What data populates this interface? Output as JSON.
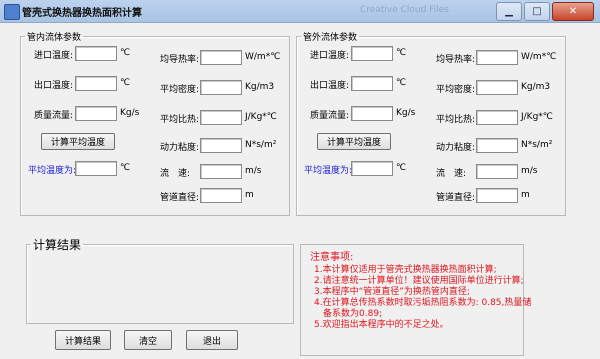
{
  "window": {
    "title": "管壳式换热器换热面积计算",
    "overlay_text": "Creative Cloud Files"
  },
  "inner_panel": {
    "legend": "管内流体参数",
    "inlet_temp_label": "进口温度:",
    "outlet_temp_label": "出口温度:",
    "mass_flow_label": "质量流量:",
    "avg_temp_button": "计算平均温度",
    "avg_temp_label": "平均温度为:",
    "unit_c1": "℃",
    "unit_c2": "℃",
    "unit_kgs": "Kg/s",
    "unit_c3": "℃",
    "thermal_cond_label": "均导热率:",
    "avg_density_label": "平均密度:",
    "avg_specific_heat_label": "平均比热:",
    "dyn_viscosity_label": "动力粘度:",
    "velocity_label": "流　速:",
    "pipe_diameter_label": "管道直径:",
    "unit_wmc": "W/m*℃",
    "unit_kgm3": "Kg/m3",
    "unit_jkgc": "J/Kg*℃",
    "unit_nsm2": "N*s/m²",
    "unit_ms": "m/s",
    "unit_m": "m"
  },
  "outer_panel": {
    "legend": "管外流体参数",
    "inlet_temp_label": "进口温度:",
    "outlet_temp_label": "出口温度:",
    "mass_flow_label": "质量流量:",
    "avg_temp_button": "计算平均温度",
    "avg_temp_label": "平均温度为:",
    "unit_c1": "℃",
    "unit_c2": "℃",
    "unit_kgs": "Kg/s",
    "unit_c3": "℃",
    "thermal_cond_label": "均导热率:",
    "avg_density_label": "平均密度:",
    "avg_specific_heat_label": "平均比热:",
    "dyn_viscosity_label": "动力粘度:",
    "velocity_label": "流　速:",
    "pipe_diameter_label": "管道直径:",
    "unit_wmc": "W/m*℃",
    "unit_kgm3": "Kg/m3",
    "unit_jkgc": "J/Kg*℃",
    "unit_nsm2": "N*s/m²",
    "unit_ms": "m/s",
    "unit_m": "m"
  },
  "result_panel": {
    "legend": "计算结果"
  },
  "notes": {
    "title": "注意事项:",
    "lines": [
      "1.本计算仅适用于管壳式换热器换热面积计算;",
      "2.请注意统一计算单位！建议使用国际单位进行计算;",
      "3.本程序中“管道直径”为换热管内直径;",
      "4.在计算总传热系数时取污垢热阻系数为: 0.85,热量储",
      "　备系数为0.89;",
      "5.欢迎指出本程序中的不足之处。"
    ]
  },
  "buttons": {
    "calculate": "计算结果",
    "clear": "清空",
    "exit": "退出"
  }
}
